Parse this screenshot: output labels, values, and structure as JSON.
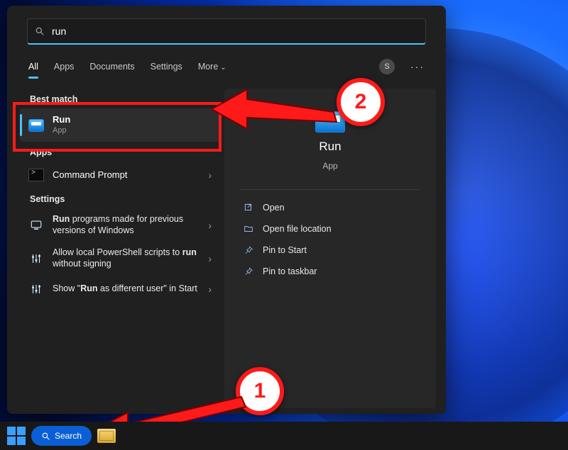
{
  "search": {
    "value": "run"
  },
  "tabs": [
    "All",
    "Apps",
    "Documents",
    "Settings",
    "More"
  ],
  "avatar_initial": "S",
  "sections": {
    "best_match": "Best match",
    "apps": "Apps",
    "settings": "Settings"
  },
  "best_match_item": {
    "title": "Run",
    "subtitle": "App"
  },
  "apps_list": [
    {
      "title": "Command Prompt"
    }
  ],
  "settings_list": [
    {
      "pre": "",
      "bold": "Run",
      "post": " programs made for previous versions of Windows"
    },
    {
      "pre": "Allow local PowerShell scripts to ",
      "bold": "run",
      "post": " without signing"
    },
    {
      "pre": "Show \"",
      "bold": "Run",
      "post": " as different user\" in Start"
    }
  ],
  "detail": {
    "title": "Run",
    "subtitle": "App",
    "actions": [
      "Open",
      "Open file location",
      "Pin to Start",
      "Pin to taskbar"
    ]
  },
  "taskbar": {
    "search_label": "Search"
  },
  "annotations": {
    "badge1": "1",
    "badge2": "2"
  }
}
